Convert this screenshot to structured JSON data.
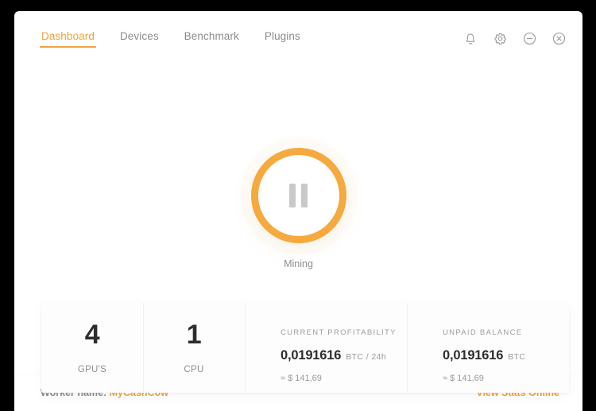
{
  "window": {
    "controls": [
      {
        "name": "notifications-icon",
        "label": "Notifications"
      },
      {
        "name": "settings-icon",
        "label": "Settings"
      },
      {
        "name": "minimize-icon",
        "label": "Minimize"
      },
      {
        "name": "close-icon",
        "label": "Close"
      }
    ]
  },
  "nav": {
    "tabs": [
      {
        "label": "Dashboard",
        "active": true
      },
      {
        "label": "Devices",
        "active": false
      },
      {
        "label": "Benchmark",
        "active": false
      },
      {
        "label": "Plugins",
        "active": false
      }
    ]
  },
  "mining": {
    "state_label": "Mining",
    "button_icon": "pause-icon",
    "ring_color": "#f5a93f"
  },
  "stats": {
    "gpu": {
      "value": "4",
      "caption": "GPU'S"
    },
    "cpu": {
      "value": "1",
      "caption": "CPU"
    },
    "profitability": {
      "title": "CURRENT PROFITABILITY",
      "amount": "0,0191616",
      "unit": "BTC / 24h",
      "fiat": "≈ $ 141,69"
    },
    "unpaid_balance": {
      "title": "UNPAID BALANCE",
      "amount": "0,0191616",
      "unit": "BTC",
      "fiat": "≈ $ 141,69"
    }
  },
  "footer": {
    "worker_label": "Worker name:",
    "worker_name": "MyCashCow",
    "stats_link": "View Stats Online"
  },
  "colors": {
    "accent": "#f0a340",
    "ring": "#f5a93f",
    "text_dark": "#2d2d2d",
    "text_muted": "#8e8e8e"
  }
}
